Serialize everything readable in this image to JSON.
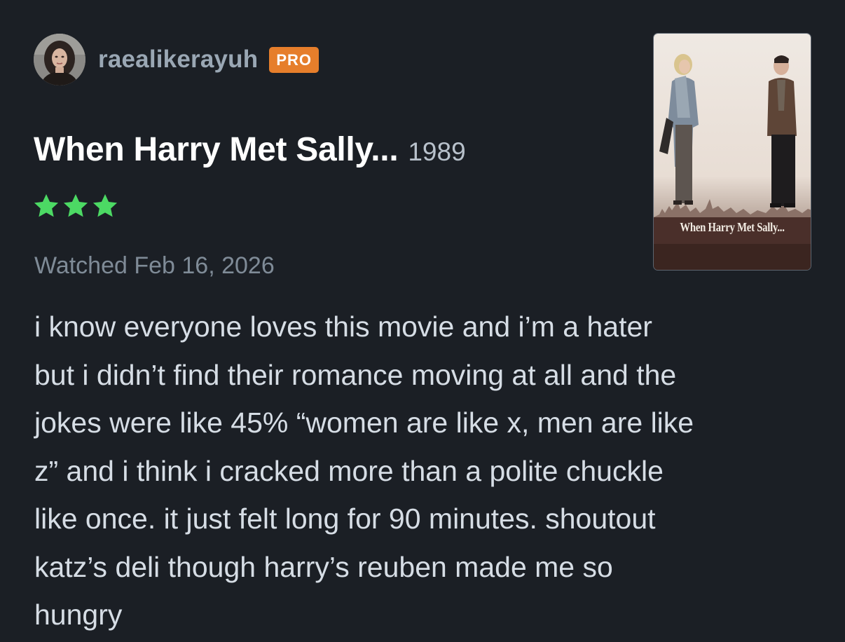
{
  "review": {
    "author": {
      "username": "raealikerayuh",
      "badge": "PRO",
      "avatar_icon": "avatar-photo"
    },
    "film": {
      "title": "When Harry Met Sally...",
      "year": "1989",
      "poster_title": "When Harry Met Sally..."
    },
    "rating": {
      "stars": 3,
      "max_stars": 5,
      "color": "#4cd964"
    },
    "watched": "Watched Feb 16, 2026",
    "body_lines": [
      "i know everyone loves this movie and i’m a hater",
      "but i didn’t find their romance moving at all and the",
      "jokes were like 45% “women are like x, men are like",
      "z” and i think i cracked more than a polite chuckle",
      "like once. it just felt long for 90 minutes. shoutout",
      "katz’s deli though harry’s reuben made me so",
      "hungry"
    ]
  },
  "colors": {
    "background": "#1b1f25",
    "badge": "#e67e2b",
    "username": "#9aa7b4",
    "title": "#ffffff",
    "muted": "#7f8b97",
    "body": "#d6dde5"
  }
}
